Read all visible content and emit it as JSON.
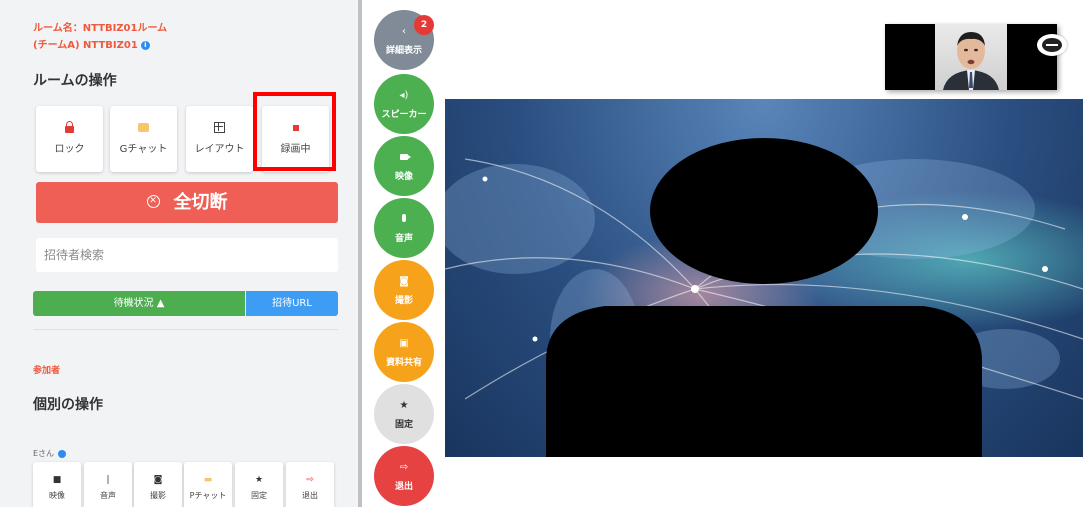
{
  "room": {
    "name_line1": "ルーム名：NTTBIZ01ルーム",
    "name_line2": "(チームA) NTTBIZ01",
    "info_icon": "i"
  },
  "room_ops": {
    "title": "ルームの操作",
    "buttons": [
      {
        "label": "ロック",
        "icon": "lock-icon"
      },
      {
        "label": "Gチャット",
        "icon": "chat-icon"
      },
      {
        "label": "レイアウト",
        "icon": "layout-icon"
      },
      {
        "label": "録画中",
        "icon": "record-icon"
      }
    ],
    "disconnect_label": "全切断",
    "disconnect_icon": "✕",
    "search_placeholder": "招待者検索",
    "status_label": "待機状況 ▲",
    "invite_url_label": "招待URL"
  },
  "participants": {
    "label": "参加者",
    "individual_title": "個別の操作",
    "member_name": "Eさん",
    "buttons": [
      {
        "label": "映像",
        "icon_glyph": "■"
      },
      {
        "label": "音声",
        "icon_glyph": "|"
      },
      {
        "label": "撮影",
        "icon_glyph": "◙"
      },
      {
        "label": "Pチャット",
        "icon_glyph": "▬"
      },
      {
        "label": "固定",
        "icon_glyph": "★"
      },
      {
        "label": "退出",
        "icon_glyph": "⇨"
      }
    ]
  },
  "sidebar_actions": [
    {
      "label": "詳細表示",
      "icon_glyph": "‹",
      "color": "#808b97"
    },
    {
      "label": "スピーカー",
      "icon_glyph": "◂)",
      "color": "#4caf50"
    },
    {
      "label": "映像",
      "icon_glyph": "",
      "color": "#4caf50"
    },
    {
      "label": "音声",
      "icon_glyph": "",
      "color": "#4caf50"
    },
    {
      "label": "撮影",
      "icon_glyph": "◙",
      "color": "#f7a21b"
    },
    {
      "label": "資料共有",
      "icon_glyph": "▣",
      "color": "#f7a21b"
    },
    {
      "label": "固定",
      "icon_glyph": "★",
      "color": "#e0e0e0"
    },
    {
      "label": "退出",
      "icon_glyph": "⇨",
      "color": "#e74242"
    }
  ],
  "detail_badge": "2",
  "colors": {
    "accent_red": "#ef5f55",
    "highlight": "#ff0000",
    "green": "#4caf50",
    "blue": "#3d9df5",
    "orange": "#f7a21b"
  }
}
